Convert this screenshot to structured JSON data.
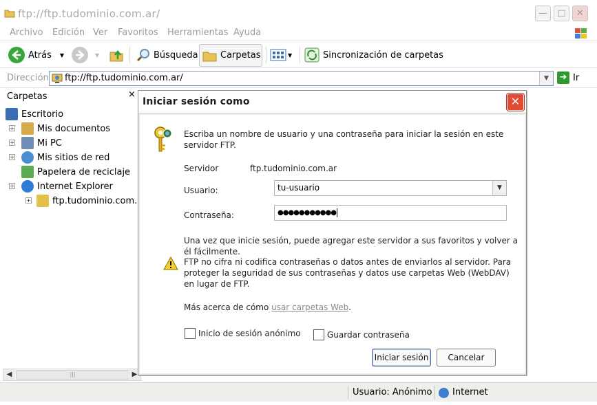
{
  "window": {
    "title": "ftp://ftp.tudominio.com.ar/"
  },
  "menu": [
    "Archivo",
    "Edición",
    "Ver",
    "Favoritos",
    "Herramientas",
    "Ayuda"
  ],
  "toolbar": {
    "back": "Atrás",
    "search": "Búsqueda",
    "folders": "Carpetas",
    "sync": "Sincronización de carpetas"
  },
  "address": {
    "label": "Dirección",
    "value": "ftp://ftp.tudominio.com.ar/",
    "go": "Ir"
  },
  "folders_pane": {
    "title": "Carpetas",
    "close": "×",
    "items": [
      {
        "label": "Escritorio",
        "level": 0,
        "expander": "",
        "icon": "desktop-icon",
        "color": "#3b6fb4"
      },
      {
        "label": "Mis documentos",
        "level": 1,
        "expander": "+",
        "icon": "my-documents-icon",
        "color": "#d6a94a"
      },
      {
        "label": "Mi PC",
        "level": 1,
        "expander": "+",
        "icon": "my-computer-icon",
        "color": "#6f8fb8"
      },
      {
        "label": "Mis sitios de red",
        "level": 1,
        "expander": "+",
        "icon": "network-places-icon",
        "color": "#4a8ed1"
      },
      {
        "label": "Papelera de reciclaje",
        "level": 1,
        "expander": "",
        "icon": "recycle-bin-icon",
        "color": "#5caa54"
      },
      {
        "label": "Internet Explorer",
        "level": 1,
        "expander": "+",
        "icon": "internet-explorer-icon",
        "color": "#2f7bd6"
      },
      {
        "label": "ftp.tudominio.com.ar",
        "level": 2,
        "expander": "+",
        "icon": "ftp-folder-icon",
        "color": "#e3c04a"
      }
    ]
  },
  "statusbar": {
    "user": "Usuario: Anónimo",
    "zone": "Internet"
  },
  "dialog": {
    "title": "Iniciar sesión como",
    "close": "✕",
    "intro": "Escriba un nombre de usuario y una contraseña para iniciar la sesión en este servidor FTP.",
    "server_label": "Servidor",
    "server_value": "ftp.tudominio.com.ar",
    "user_label": "Usuario:",
    "user_value": "tu-usuario",
    "password_label": "Contraseña:",
    "password_value": "●●●●●●●●●●●",
    "note1": "Una vez que inicie sesión, puede agregar este servidor a sus favoritos y volver a él fácilmente.",
    "note2": "FTP no cifra ni codifica contraseñas o datos antes de enviarlos al servidor.  Para proteger la seguridad de sus contraseñas y datos use carpetas Web (WebDAV) en lugar de FTP.",
    "more_prefix": "Más acerca de cómo ",
    "more_link": "usar carpetas Web",
    "more_suffix": ".",
    "anonymous": "Inicio de sesión anónimo",
    "save_password": "Guardar contraseña",
    "login_button": "Iniciar sesión",
    "cancel_button": "Cancelar"
  }
}
